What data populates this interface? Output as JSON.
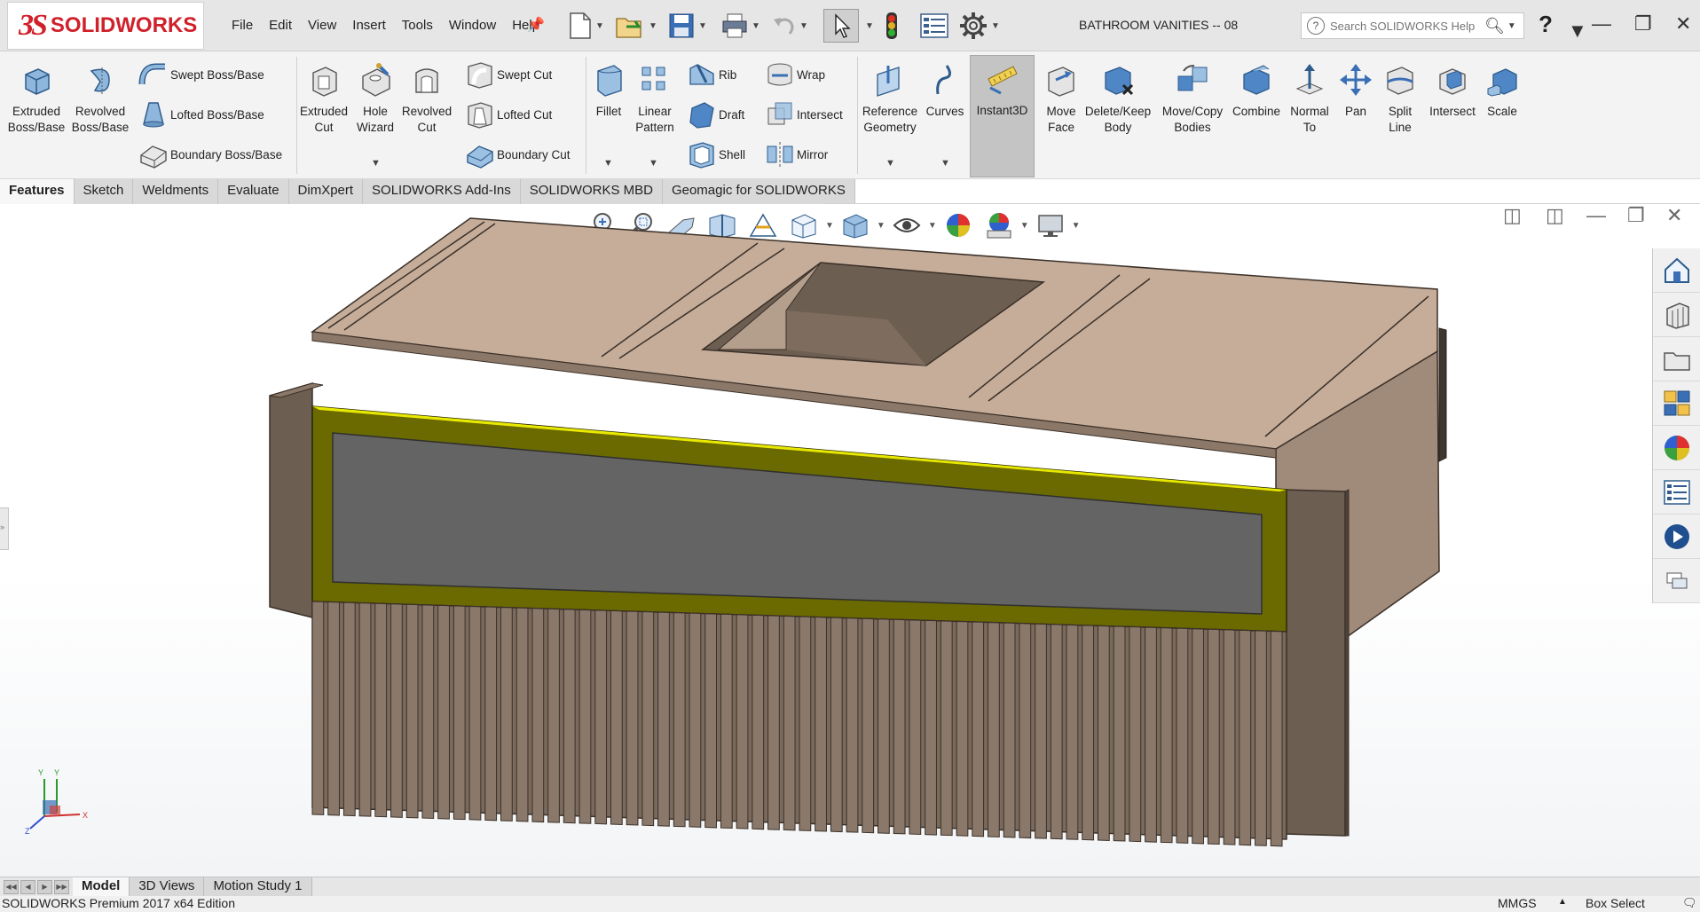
{
  "app": {
    "brand_prefix": "3S",
    "brand_name": "SOLIDWORKS",
    "document_title": "BATHROOM VANITIES -- 08"
  },
  "menu": [
    "File",
    "Edit",
    "View",
    "Insert",
    "Tools",
    "Window",
    "Help"
  ],
  "search": {
    "placeholder": "Search SOLIDWORKS Help"
  },
  "ribbon": {
    "extruded_boss": [
      "Extruded",
      "Boss/Base"
    ],
    "revolved_boss": [
      "Revolved",
      "Boss/Base"
    ],
    "swept_boss": "Swept Boss/Base",
    "lofted_boss": "Lofted Boss/Base",
    "boundary_boss": "Boundary Boss/Base",
    "extruded_cut": [
      "Extruded",
      "Cut"
    ],
    "hole_wizard": [
      "Hole",
      "Wizard"
    ],
    "revolved_cut": [
      "Revolved",
      "Cut"
    ],
    "swept_cut": "Swept Cut",
    "lofted_cut": "Lofted Cut",
    "boundary_cut": "Boundary Cut",
    "fillet": "Fillet",
    "linear_pattern": [
      "Linear",
      "Pattern"
    ],
    "rib": "Rib",
    "draft": "Draft",
    "shell": "Shell",
    "wrap": "Wrap",
    "intersect_small": "Intersect",
    "mirror": "Mirror",
    "reference_geometry": [
      "Reference",
      "Geometry"
    ],
    "curves": "Curves",
    "instant3d": "Instant3D",
    "move_face": [
      "Move",
      "Face"
    ],
    "delete_keep_body": [
      "Delete/Keep",
      "Body"
    ],
    "move_copy_bodies": [
      "Move/Copy",
      "Bodies"
    ],
    "combine": "Combine",
    "normal_to": [
      "Normal",
      "To"
    ],
    "pan": "Pan",
    "split_line": [
      "Split",
      "Line"
    ],
    "intersect": "Intersect",
    "scale": "Scale"
  },
  "tabs": [
    "Features",
    "Sketch",
    "Weldments",
    "Evaluate",
    "DimXpert",
    "SOLIDWORKS Add-Ins",
    "SOLIDWORKS MBD",
    "Geomagic for SOLIDWORKS"
  ],
  "active_tab": "Features",
  "triad": {
    "y": "Y",
    "x": "X",
    "z": "Z"
  },
  "bottom_tabs": [
    "Model",
    "3D Views",
    "Motion Study 1"
  ],
  "active_bottom_tab": "Model",
  "status": {
    "edition": "SOLIDWORKS Premium 2017 x64 Edition",
    "units": "MMGS",
    "mode": "Box Select"
  },
  "colors": {
    "brand_red": "#d0202a",
    "cabinet_top": "#c5ad9a",
    "cabinet_side": "#a08a7a",
    "cabinet_dark": "#6d5e52",
    "selected_frame": "#6b6a00",
    "drawer_panel": "#646464"
  }
}
